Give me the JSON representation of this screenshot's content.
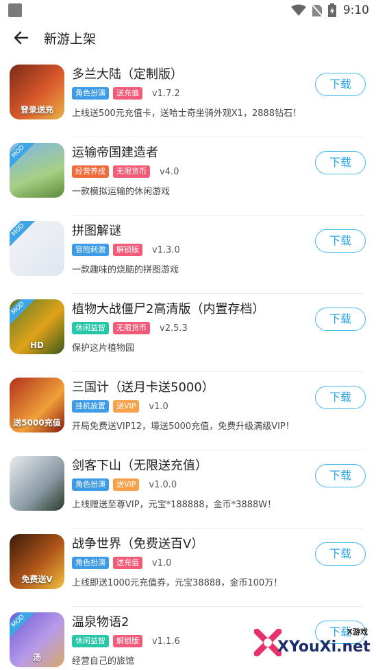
{
  "status": {
    "time": "9:10"
  },
  "header": {
    "title": "新游上架"
  },
  "games": [
    {
      "name": "多兰大陆（定制版）",
      "tags": [
        {
          "label": "角色扮演",
          "color": "#3e9be6"
        },
        {
          "label": "送充值",
          "color": "#f25a78"
        }
      ],
      "version": "v1.7.2",
      "desc": "上线送500元充值卡，送哈士奇坐骑外观X1，2888钻石！",
      "download": "下载",
      "icon_text": "登录送充",
      "icon_bg": "linear-gradient(135deg,#7a2a18,#d9582a 55%,#e8b24a)",
      "mod": false
    },
    {
      "name": "运输帝国建造者",
      "tags": [
        {
          "label": "经营养成",
          "color": "#f06a3a"
        },
        {
          "label": "无限货币",
          "color": "#f25a78"
        }
      ],
      "version": "v4.0",
      "desc": "一款模拟运输的休闲游戏",
      "download": "下载",
      "icon_text": "",
      "icon_bg": "linear-gradient(160deg,#7fb7e8,#a7cf84 60%,#5a8a3a)",
      "mod": true
    },
    {
      "name": "拼图解谜",
      "tags": [
        {
          "label": "冒险刺激",
          "color": "#3e9be6"
        },
        {
          "label": "解锁版",
          "color": "#f25a78"
        }
      ],
      "version": "v1.3.0",
      "desc": "一款趣味的烧脑的拼图游戏",
      "download": "下载",
      "icon_text": "",
      "icon_bg": "linear-gradient(135deg,#f2f5f8,#dfe6ee)",
      "mod": true
    },
    {
      "name": "植物大战僵尸2高清版（内置存档）",
      "tags": [
        {
          "label": "休闲益智",
          "color": "#26c6a6"
        },
        {
          "label": "无限货币",
          "color": "#f25a78"
        }
      ],
      "version": "v2.5.3",
      "desc": "保护这片植物园",
      "download": "下载",
      "icon_text": "HD",
      "icon_bg": "linear-gradient(135deg,#5a7a2a,#e0a21a 55%,#3b5a1a)",
      "mod": true
    },
    {
      "name": "三国计（送月卡送5000）",
      "tags": [
        {
          "label": "挂机放置",
          "color": "#3e9be6"
        },
        {
          "label": "送VIP",
          "color": "#f7a14a"
        }
      ],
      "version": "v1.0",
      "desc": "开局免费送VIP12，壕送5000充值，免费升级满级VIP！",
      "download": "下载",
      "icon_text": "送5000充值",
      "icon_bg": "linear-gradient(135deg,#b0301c,#f0a03a 60%,#8a1a10)",
      "mod": false
    },
    {
      "name": "剑客下山（无限送充值）",
      "tags": [
        {
          "label": "角色扮演",
          "color": "#3e9be6"
        },
        {
          "label": "送VIP",
          "color": "#f7a14a"
        }
      ],
      "version": "v1.0.0",
      "desc": "上线赠送至尊VIP，元宝*188888，金币*3888W！",
      "download": "下载",
      "icon_text": "",
      "icon_bg": "linear-gradient(135deg,#e9ecef,#8a9aa4 60%,#2a3a2a)",
      "mod": false
    },
    {
      "name": "战争世界（免费送百V）",
      "tags": [
        {
          "label": "角色扮演",
          "color": "#3e9be6"
        },
        {
          "label": "送充值",
          "color": "#f25a78"
        }
      ],
      "version": "v1.0",
      "desc": "上线即送1000元充值券，元宝38888，金币100万！",
      "download": "下载",
      "icon_text": "免费送V",
      "icon_bg": "linear-gradient(135deg,#3a1a0a,#b0561a 55%,#f0c040)",
      "mod": false
    },
    {
      "name": "温泉物语2",
      "tags": [
        {
          "label": "休闲益智",
          "color": "#26c6a6"
        },
        {
          "label": "解锁版",
          "color": "#f25a78"
        }
      ],
      "version": "v1.1.6",
      "desc": "经营自己的旅馆",
      "download": "下载",
      "icon_text": "汤",
      "icon_bg": "linear-gradient(135deg,#6a5ad8,#b89ae8 55%,#d8a86a)",
      "mod": true
    }
  ],
  "watermark": {
    "brand": "XYouXi.net",
    "small": "X游戏"
  }
}
